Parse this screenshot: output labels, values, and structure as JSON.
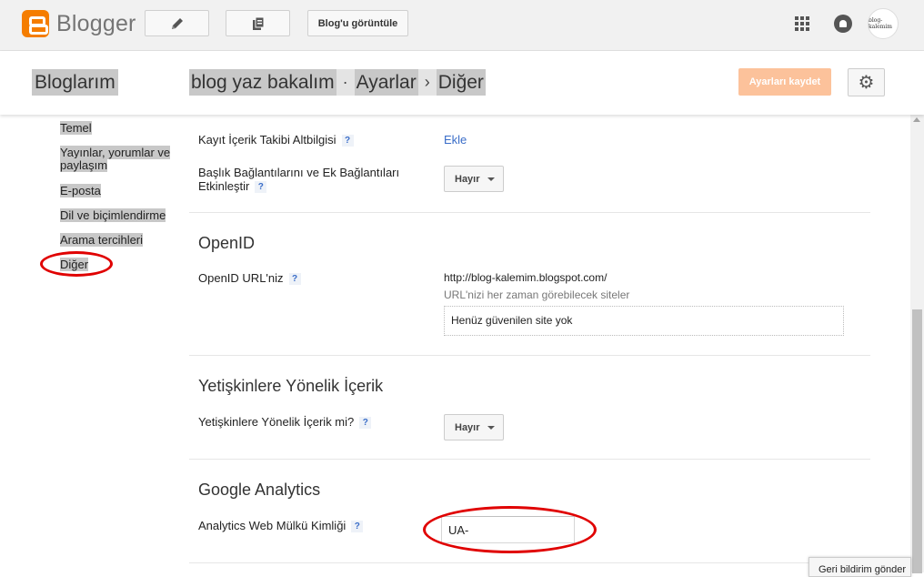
{
  "topbar": {
    "brand": "Blogger",
    "view_blog_label": "Blog'u görüntüle",
    "avatar_text": "blog-kalemim"
  },
  "header": {
    "my_blogs": "Bloglarım",
    "blog_name": "blog yaz bakalım",
    "crumb_sep_1": "·",
    "section": "Ayarlar",
    "crumb_sep_2": "›",
    "page": "Diğer",
    "save_label": "Ayarları kaydet"
  },
  "sidebar": {
    "items": [
      {
        "label": "Temel"
      },
      {
        "label": "Yayınlar, yorumlar ve paylaşım"
      },
      {
        "label": "E-posta"
      },
      {
        "label": "Dil ve biçimlendirme"
      },
      {
        "label": "Arama tercihleri"
      },
      {
        "label": "Diğer"
      }
    ]
  },
  "content": {
    "footer_tracking": {
      "label": "Kayıt İçerik Takibi Altbilgisi",
      "help": "?",
      "action": "Ekle"
    },
    "title_links": {
      "label_line1": "Başlık Bağlantılarını ve Ek Bağlantıları",
      "label_line2": "Etkinleştir",
      "help": "?",
      "value": "Hayır"
    },
    "openid": {
      "title": "OpenID",
      "label": "OpenID URL'niz",
      "help": "?",
      "url": "http://blog-kalemim.blogspot.com/",
      "trusted_caption": "URL'nizi her zaman görebilecek siteler",
      "trusted_empty": "Henüz güvenilen site yok"
    },
    "adult": {
      "title": "Yetişkinlere Yönelik İçerik",
      "label": "Yetişkinlere Yönelik İçerik mi?",
      "help": "?",
      "value": "Hayır"
    },
    "analytics": {
      "title": "Google Analytics",
      "label": "Analytics Web Mülkü Kimliği",
      "help": "?",
      "value": "UA-"
    }
  },
  "feedback_label": "Geri bildirim gönder",
  "colors": {
    "brand_orange": "#f57d00",
    "save_button": "#fcc29b",
    "link_blue": "#3a6dc8",
    "annotation_red": "#e00000"
  }
}
